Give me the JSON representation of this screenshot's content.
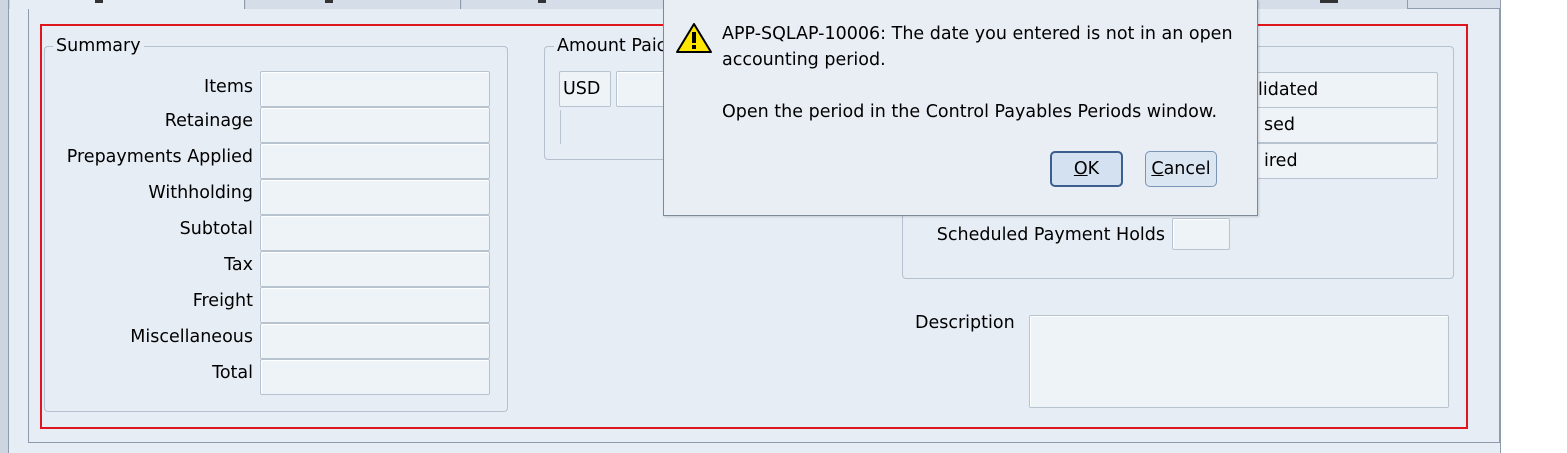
{
  "summary": {
    "legend": "Summary",
    "rows": [
      {
        "label": "Items",
        "value": ""
      },
      {
        "label": "Retainage",
        "value": ""
      },
      {
        "label": "Prepayments Applied",
        "value": ""
      },
      {
        "label": "Withholding",
        "value": ""
      },
      {
        "label": "Subtotal",
        "value": ""
      },
      {
        "label": "Tax",
        "value": ""
      },
      {
        "label": "Freight",
        "value": ""
      },
      {
        "label": "Miscellaneous",
        "value": ""
      },
      {
        "label": "Total",
        "value": ""
      }
    ]
  },
  "amount_paid": {
    "legend": "Amount Paic",
    "currency": "USD",
    "value": ""
  },
  "status": {
    "values": [
      "lidated",
      "sed",
      "ired"
    ],
    "scheduled_label": "Scheduled Payment Holds",
    "scheduled_value": ""
  },
  "description": {
    "label": "Description",
    "value": ""
  },
  "dialog": {
    "line1": "APP-SQLAP-10006: The date you entered is not in an open",
    "line2": "accounting period.",
    "line3": "Open the period in the Control Payables Periods window.",
    "ok_mnemonic": "O",
    "ok_rest": "K",
    "cancel_mnemonic": "C",
    "cancel_rest": "ancel"
  }
}
